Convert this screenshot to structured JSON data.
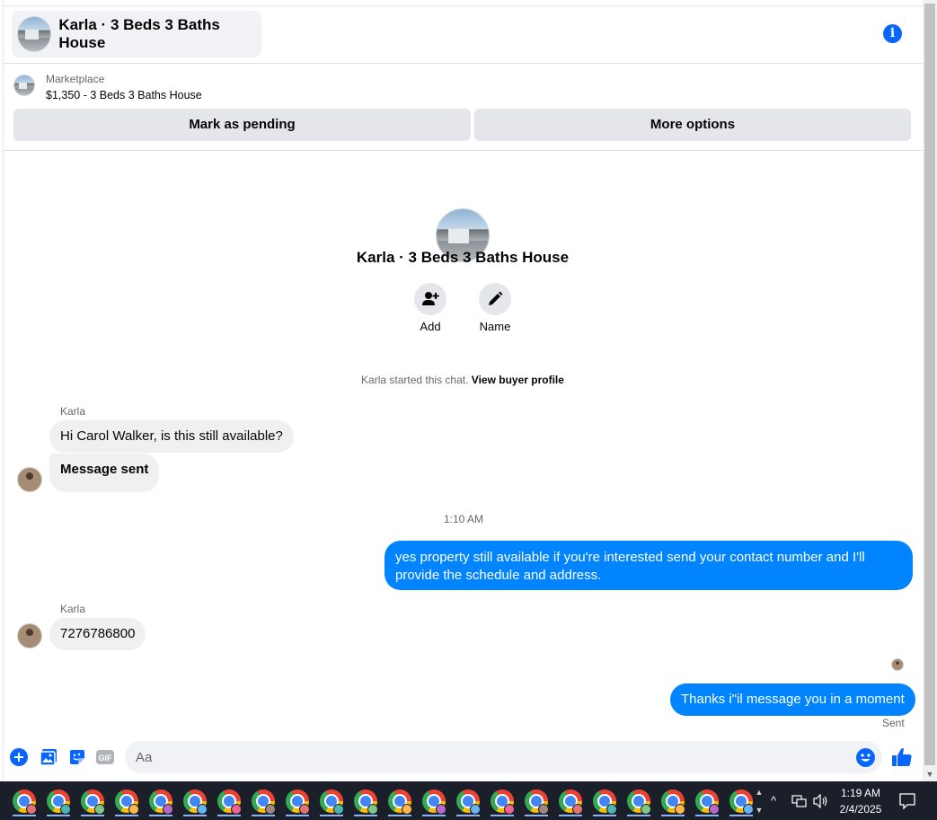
{
  "header": {
    "title": "Karla · 3 Beds 3 Baths House",
    "info_icon": "info-icon"
  },
  "marketplace": {
    "label": "Marketplace",
    "listing": "$1,350 - 3 Beds 3 Baths House",
    "mark_pending_label": "Mark as pending",
    "more_options_label": "More options"
  },
  "profile": {
    "name": "Karla · 3 Beds 3 Baths House",
    "add_label": "Add",
    "name_label": "Name",
    "system_text": "Karla started this chat.",
    "system_link": "View buyer profile"
  },
  "messages": {
    "sender_1": "Karla",
    "msg_1": "Hi Carol Walker, is this still available?",
    "msg_2": "Message sent",
    "timestamp": "1:10 AM",
    "msg_3": "yes property still available if you're interested send your contact number and I'll provide the schedule and address.",
    "sender_2": "Karla",
    "msg_4": "7276786800",
    "msg_5": "Thanks i\"il message you in a moment",
    "status": "Sent"
  },
  "composer": {
    "placeholder": "Aa",
    "icons": [
      "plus-icon",
      "photo-icon",
      "sticker-icon",
      "gif-icon",
      "emoji-icon",
      "like-icon"
    ],
    "gif_label": "GIF"
  },
  "taskbar": {
    "app_count": 22,
    "clock_time": "1:19 AM",
    "clock_date": "2/4/2025"
  },
  "colors": {
    "accent": "#0866ff",
    "outgoing_bubble": "#0084ff",
    "incoming_bubble": "#f0f0f0",
    "button_gray": "#e4e6eb",
    "taskbar": "#1b1f2a"
  }
}
